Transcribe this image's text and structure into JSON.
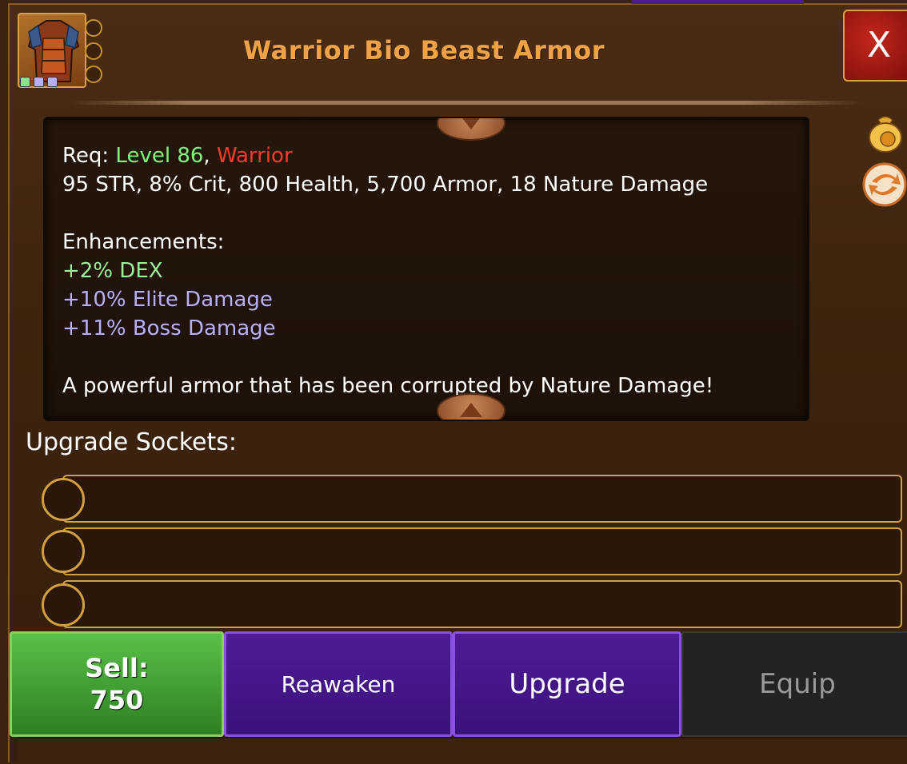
{
  "item": {
    "title": "Warrior Bio Beast Armor",
    "gem_slots": [
      "#8fe08a",
      "#b8b0ff",
      "#b8b0ff"
    ]
  },
  "close": {
    "label": "X"
  },
  "requirements": {
    "prefix": "Req: ",
    "level": "Level 86",
    "separator": ", ",
    "class": "Warrior"
  },
  "stats": "95 STR, 8% Crit, 800 Health, 5,700 Armor, 18 Nature Damage",
  "enhancements": {
    "heading": "Enhancements:",
    "items": [
      "+2% DEX",
      "+10% Elite Damage",
      "+11% Boss Damage"
    ]
  },
  "description": "A powerful armor that has been corrupted by Nature Damage!",
  "sockets": {
    "label": "Upgrade Sockets:"
  },
  "buttons": {
    "sell_label": "Sell:",
    "sell_price": "750",
    "reawaken": "Reawaken",
    "upgrade": "Upgrade",
    "equip": "Equip"
  },
  "side_icons": [
    "gold-bag-icon",
    "swap-icon"
  ]
}
